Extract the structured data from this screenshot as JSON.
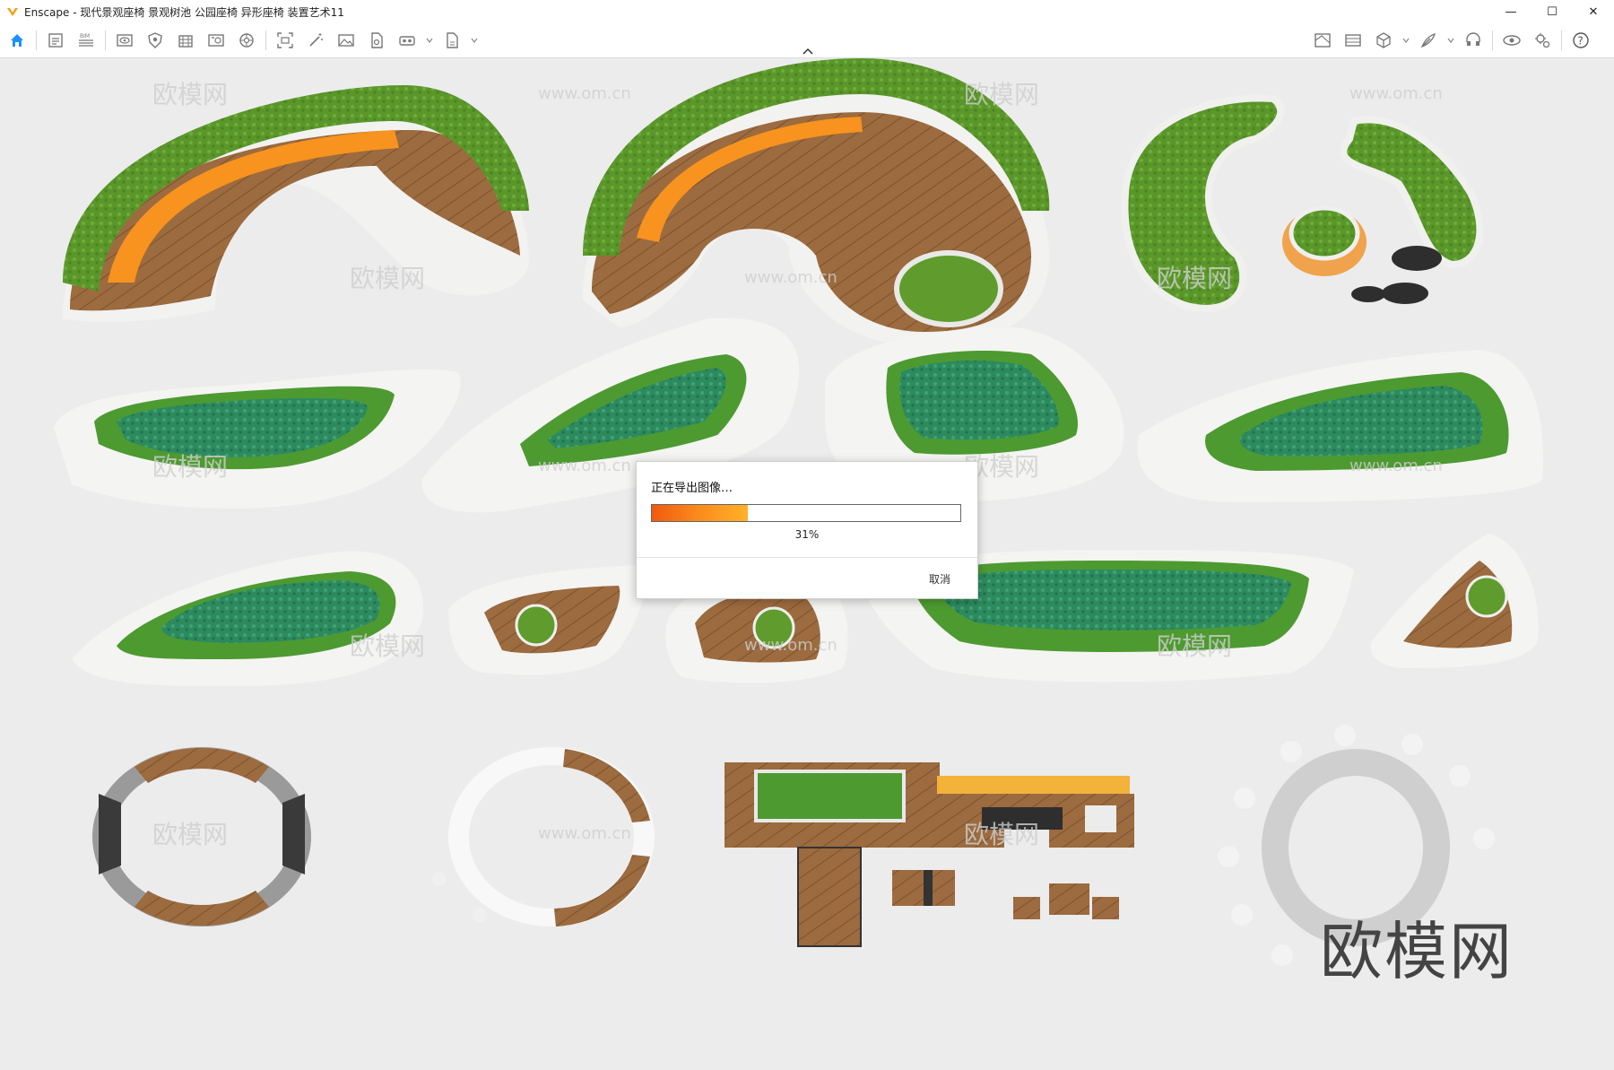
{
  "window": {
    "title": "Enscape - 现代景观座椅 景观树池 公园座椅 异形座椅 装置艺术11",
    "minimize": "—",
    "maximize": "☐",
    "close": "✕"
  },
  "toolbar": {
    "left_icons": [
      "home-icon",
      "document-icon",
      "bim-icon",
      "eye-view-icon",
      "shield-icon",
      "building-icon",
      "image-gallery-icon",
      "settings-wheel-icon",
      "capture-icon",
      "magic-wand-icon",
      "landscape-image-icon",
      "file-export-icon",
      "vr-headset-icon",
      "export-doc-icon"
    ],
    "right_icons": [
      "map-icon",
      "panorama-icon",
      "cube-icon",
      "feather-icon",
      "headset-icon",
      "visibility-eye-icon",
      "gear-settings-icon",
      "help-icon"
    ],
    "help_label": "?"
  },
  "dialog": {
    "title": "正在导出图像…",
    "progress": 0.31,
    "progress_label": "31%",
    "cancel_label": "取消"
  },
  "scene": {
    "watermark": "欧模网",
    "watermark_url": "www.om.cn",
    "brand_mark": "欧模网"
  },
  "colors": {
    "accent_orange": "#f7931e",
    "grass_green": "#5a9a2a",
    "water_green": "#2f8a5e",
    "wood": "#9a6a3e",
    "concrete": "#f4f4f2"
  }
}
